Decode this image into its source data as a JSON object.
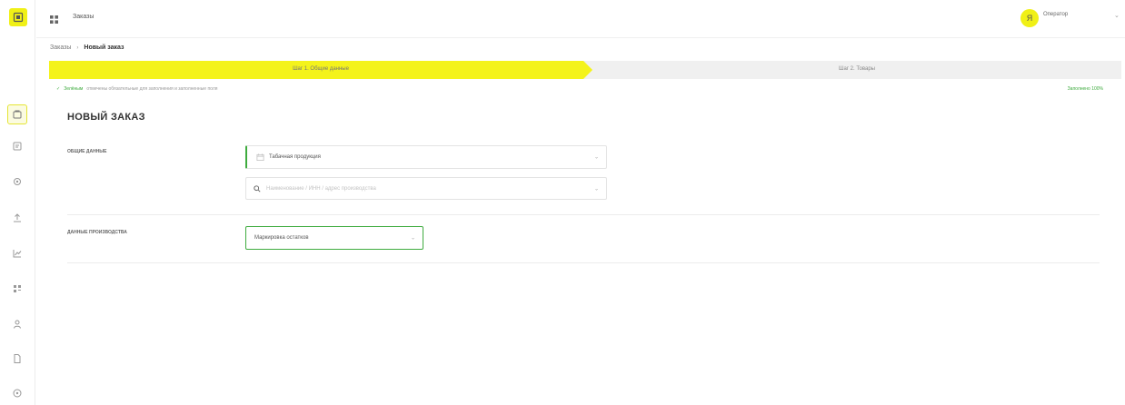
{
  "topbar": {
    "title": "Заказы"
  },
  "user": {
    "avatar_letter": "Я",
    "role": "Оператор"
  },
  "breadcrumb": {
    "root": "Заказы",
    "separator": "›",
    "current": "Новый заказ"
  },
  "stepper": {
    "steps": [
      {
        "label": "Шаг 1. Общие данные",
        "active": true
      },
      {
        "label": "Шаг 2. Товары",
        "active": false
      }
    ]
  },
  "hint": {
    "check": "✓",
    "green_word": "Зелёным",
    "text": "отмечены обязательные для заполнения и заполненные поля",
    "filled": "Заполнено 100%"
  },
  "page_title": "НОВЫЙ ЗАКАЗ",
  "section_general": {
    "label": "ОБЩИЕ ДАННЫЕ",
    "product_type_value": "Табачная продукция",
    "search_placeholder": "Наименование / ИНН / адрес производства"
  },
  "section_production": {
    "label": "ДАННЫЕ ПРОИЗВОДСТВА",
    "production_value": "Маркировка остатков"
  },
  "colors": {
    "accent": "#f4f31b",
    "success": "#3eab3e"
  },
  "icons": {
    "rail": [
      "orders-icon",
      "document-icon",
      "settings-icon",
      "upload-icon",
      "chart-icon",
      "grid-icon",
      "user-icon",
      "file-icon",
      "help-icon"
    ]
  }
}
